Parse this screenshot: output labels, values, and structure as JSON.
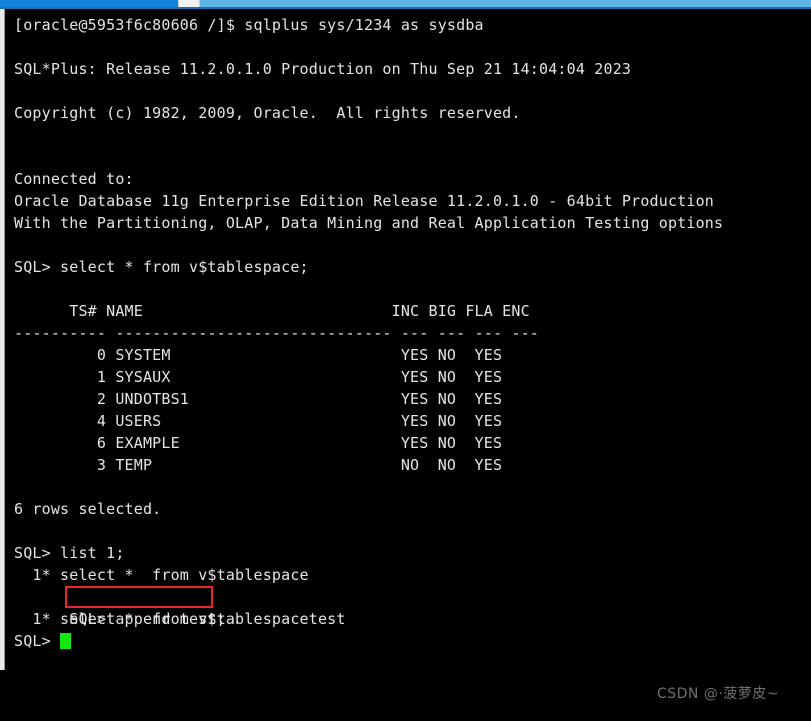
{
  "window": {
    "title_bar": {
      "accent_color": "#0f84d8",
      "secondary_color": "#5fb4e8",
      "tab_gap_color": "#f2f2f2"
    },
    "background_color": "#000000",
    "foreground_color": "#e4e4e4"
  },
  "terminal": {
    "prompt_shell": "[oracle@5953f6c80606 /]$",
    "prompt_sql": "SQL>",
    "cursor": {
      "type": "block-cursor",
      "color": "#15e715"
    },
    "lines": [
      {
        "id": "shell-command",
        "text": "[oracle@5953f6c80606 /]$ sqlplus sys/1234 as sysdba"
      },
      {
        "id": "blank-1",
        "text": ""
      },
      {
        "id": "sqlplus-banner",
        "text": "SQL*Plus: Release 11.2.0.1.0 Production on Thu Sep 21 14:04:04 2023"
      },
      {
        "id": "blank-2",
        "text": ""
      },
      {
        "id": "copyright",
        "text": "Copyright (c) 1982, 2009, Oracle.  All rights reserved."
      },
      {
        "id": "blank-3",
        "text": ""
      },
      {
        "id": "blank-4",
        "text": ""
      },
      {
        "id": "connected-to",
        "text": "Connected to:"
      },
      {
        "id": "db-version",
        "text": "Oracle Database 11g Enterprise Edition Release 11.2.0.1.0 - 64bit Production"
      },
      {
        "id": "db-options",
        "text": "With the Partitioning, OLAP, Data Mining and Real Application Testing options"
      },
      {
        "id": "blank-5",
        "text": ""
      },
      {
        "id": "query-1",
        "text": "SQL> select * from v$tablespace;"
      },
      {
        "id": "blank-6",
        "text": ""
      },
      {
        "id": "table-header",
        "text": "      TS# NAME                           INC BIG FLA ENC"
      },
      {
        "id": "table-rule",
        "text": "---------- ------------------------------ --- --- --- ---"
      },
      {
        "id": "row-system",
        "text": "         0 SYSTEM                         YES NO  YES"
      },
      {
        "id": "row-sysaux",
        "text": "         1 SYSAUX                         YES NO  YES"
      },
      {
        "id": "row-undotbs1",
        "text": "         2 UNDOTBS1                       YES NO  YES"
      },
      {
        "id": "row-users",
        "text": "         4 USERS                          YES NO  YES"
      },
      {
        "id": "row-example",
        "text": "         6 EXAMPLE                        YES NO  YES"
      },
      {
        "id": "row-temp",
        "text": "         3 TEMP                           NO  NO  YES"
      },
      {
        "id": "blank-7",
        "text": ""
      },
      {
        "id": "rows-selected",
        "text": "6 rows selected."
      },
      {
        "id": "blank-8",
        "text": ""
      },
      {
        "id": "cmd-list",
        "text": "SQL> list 1;"
      },
      {
        "id": "buffer-1",
        "text": "  1* select *  from v$tablespace"
      },
      {
        "id": "cmd-append",
        "text": "SQL> append test;"
      },
      {
        "id": "buffer-2",
        "text": "  1* select *  from v$tablespacetest"
      },
      {
        "id": "prompt-final",
        "text": "SQL> "
      }
    ]
  },
  "query_result": {
    "statement": "select * from v$tablespace;",
    "columns": [
      "TS#",
      "NAME",
      "INC",
      "BIG",
      "FLA",
      "ENC"
    ],
    "rows": [
      [
        "0",
        "SYSTEM",
        "YES",
        "NO",
        "YES",
        ""
      ],
      [
        "1",
        "SYSAUX",
        "YES",
        "NO",
        "YES",
        ""
      ],
      [
        "2",
        "UNDOTBS1",
        "YES",
        "NO",
        "YES",
        ""
      ],
      [
        "4",
        "USERS",
        "YES",
        "NO",
        "YES",
        ""
      ],
      [
        "6",
        "EXAMPLE",
        "YES",
        "NO",
        "YES",
        ""
      ],
      [
        "3",
        "TEMP",
        "NO",
        "NO",
        "YES",
        ""
      ]
    ],
    "row_count_text": "6 rows selected."
  },
  "annotation": {
    "type": "red-highlight-box",
    "target_text": "append test;",
    "border_color": "#e8272c"
  },
  "watermark": {
    "text": "CSDN @·菠萝皮~",
    "color": "#6f6f6f"
  }
}
